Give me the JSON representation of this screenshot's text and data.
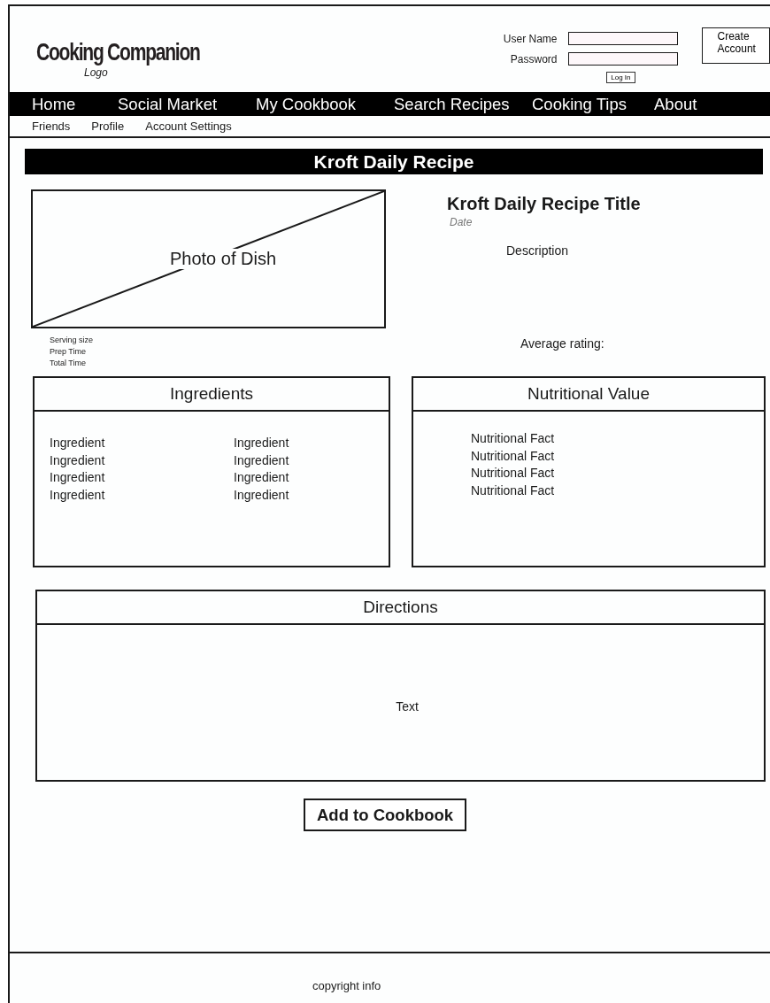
{
  "header": {
    "logo": "Cooking Companion",
    "logo_caption": "Logo",
    "username_label": "User Name",
    "password_label": "Password",
    "login_button": "Log In",
    "create_account_button": "Create Account"
  },
  "nav": [
    "Home",
    "Social Market",
    "My Cookbook",
    "Search Recipes",
    "Cooking Tips",
    "About"
  ],
  "subnav": [
    "Friends",
    "Profile",
    "Account Settings"
  ],
  "banner": "Kroft Daily Recipe",
  "recipe": {
    "photo_label": "Photo of Dish",
    "details": [
      "Serving size",
      "Prep Time",
      "Total Time"
    ],
    "title": "Kroft Daily Recipe Title",
    "date": "Date",
    "description": "Description",
    "rating_label": "Average rating:"
  },
  "ingredients": {
    "title": "Ingredients",
    "items": [
      "Ingredient",
      "Ingredient",
      "Ingredient",
      "Ingredient",
      "Ingredient",
      "Ingredient",
      "Ingredient",
      "Ingredient"
    ]
  },
  "nutrition": {
    "title": "Nutritional Value",
    "items": [
      "Nutritional Fact",
      "Nutritional Fact",
      "Nutritional Fact",
      "Nutritional Fact"
    ]
  },
  "directions": {
    "title": "Directions",
    "text": "Text"
  },
  "add_button": "Add to Cookbook",
  "footer": "copyright info"
}
